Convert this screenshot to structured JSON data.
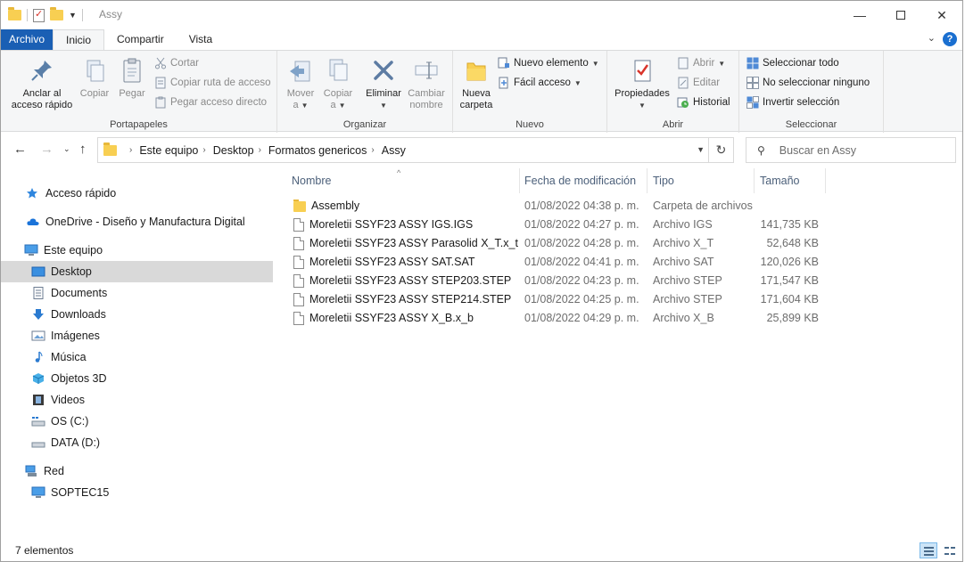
{
  "window": {
    "title": "Assy",
    "controls": {
      "minimize": "—",
      "maximize": "",
      "close": "✕"
    }
  },
  "ribbon_tabs": [
    "Archivo",
    "Inicio",
    "Compartir",
    "Vista"
  ],
  "help_label": "?",
  "ribbon": {
    "portapapeles": {
      "label": "Portapapeles",
      "pin": "Anclar al acceso rápido",
      "pin_line1": "Anclar al",
      "pin_line2": "acceso rápido",
      "copy": "Copiar",
      "paste": "Pegar",
      "cut": "Cortar",
      "copy_path": "Copiar ruta de acceso",
      "paste_shortcut": "Pegar acceso directo"
    },
    "organizar": {
      "label": "Organizar",
      "move_line1": "Mover",
      "move_line2": "a",
      "copy_line1": "Copiar",
      "copy_line2": "a",
      "delete": "Eliminar",
      "rename_line1": "Cambiar",
      "rename_line2": "nombre"
    },
    "nuevo": {
      "label": "Nuevo",
      "new_folder_line1": "Nueva",
      "new_folder_line2": "carpeta",
      "new_item": "Nuevo elemento",
      "easy_access": "Fácil acceso"
    },
    "abrir": {
      "label": "Abrir",
      "properties": "Propiedades",
      "open": "Abrir",
      "edit": "Editar",
      "history": "Historial"
    },
    "seleccionar": {
      "label": "Seleccionar",
      "select_all": "Seleccionar todo",
      "select_none": "No seleccionar ninguno",
      "invert": "Invertir selección"
    }
  },
  "address": {
    "breadcrumbs": [
      "Este equipo",
      "Desktop",
      "Formatos genericos",
      "Assy"
    ],
    "search_placeholder": "Buscar en Assy"
  },
  "nav": {
    "quick_access": "Acceso rápido",
    "onedrive": "OneDrive - Diseño y Manufactura Digital",
    "this_pc": "Este equipo",
    "items": [
      "Desktop",
      "Documents",
      "Downloads",
      "Imágenes",
      "Música",
      "Objetos 3D",
      "Videos",
      "OS (C:)",
      "DATA (D:)"
    ],
    "selected": "Desktop",
    "network": "Red",
    "network_items": [
      "SOPTEC15"
    ]
  },
  "columns": {
    "name": "Nombre",
    "date": "Fecha de modificación",
    "type": "Tipo",
    "size": "Tamaño"
  },
  "files": [
    {
      "name": "Assembly",
      "date": "01/08/2022 04:38 p. m.",
      "type": "Carpeta de archivos",
      "size": "",
      "kind": "folder"
    },
    {
      "name": "Moreletii SSYF23 ASSY IGS.IGS",
      "date": "01/08/2022 04:27 p. m.",
      "type": "Archivo IGS",
      "size": "141,735 KB",
      "kind": "file"
    },
    {
      "name": "Moreletii SSYF23 ASSY Parasolid X_T.x_t",
      "date": "01/08/2022 04:28 p. m.",
      "type": "Archivo X_T",
      "size": "52,648 KB",
      "kind": "file"
    },
    {
      "name": "Moreletii SSYF23 ASSY SAT.SAT",
      "date": "01/08/2022 04:41 p. m.",
      "type": "Archivo SAT",
      "size": "120,026 KB",
      "kind": "file"
    },
    {
      "name": "Moreletii SSYF23 ASSY STEP203.STEP",
      "date": "01/08/2022 04:23 p. m.",
      "type": "Archivo STEP",
      "size": "171,547 KB",
      "kind": "file"
    },
    {
      "name": "Moreletii SSYF23 ASSY STEP214.STEP",
      "date": "01/08/2022 04:25 p. m.",
      "type": "Archivo STEP",
      "size": "171,604 KB",
      "kind": "file"
    },
    {
      "name": "Moreletii SSYF23 ASSY X_B.x_b",
      "date": "01/08/2022 04:29 p. m.",
      "type": "Archivo X_B",
      "size": "25,899 KB",
      "kind": "file"
    }
  ],
  "status": {
    "count": "7 elementos"
  },
  "colors": {
    "accent": "#1a5fb4",
    "folder": "#f8cf52",
    "selection": "#d9d9d9"
  }
}
